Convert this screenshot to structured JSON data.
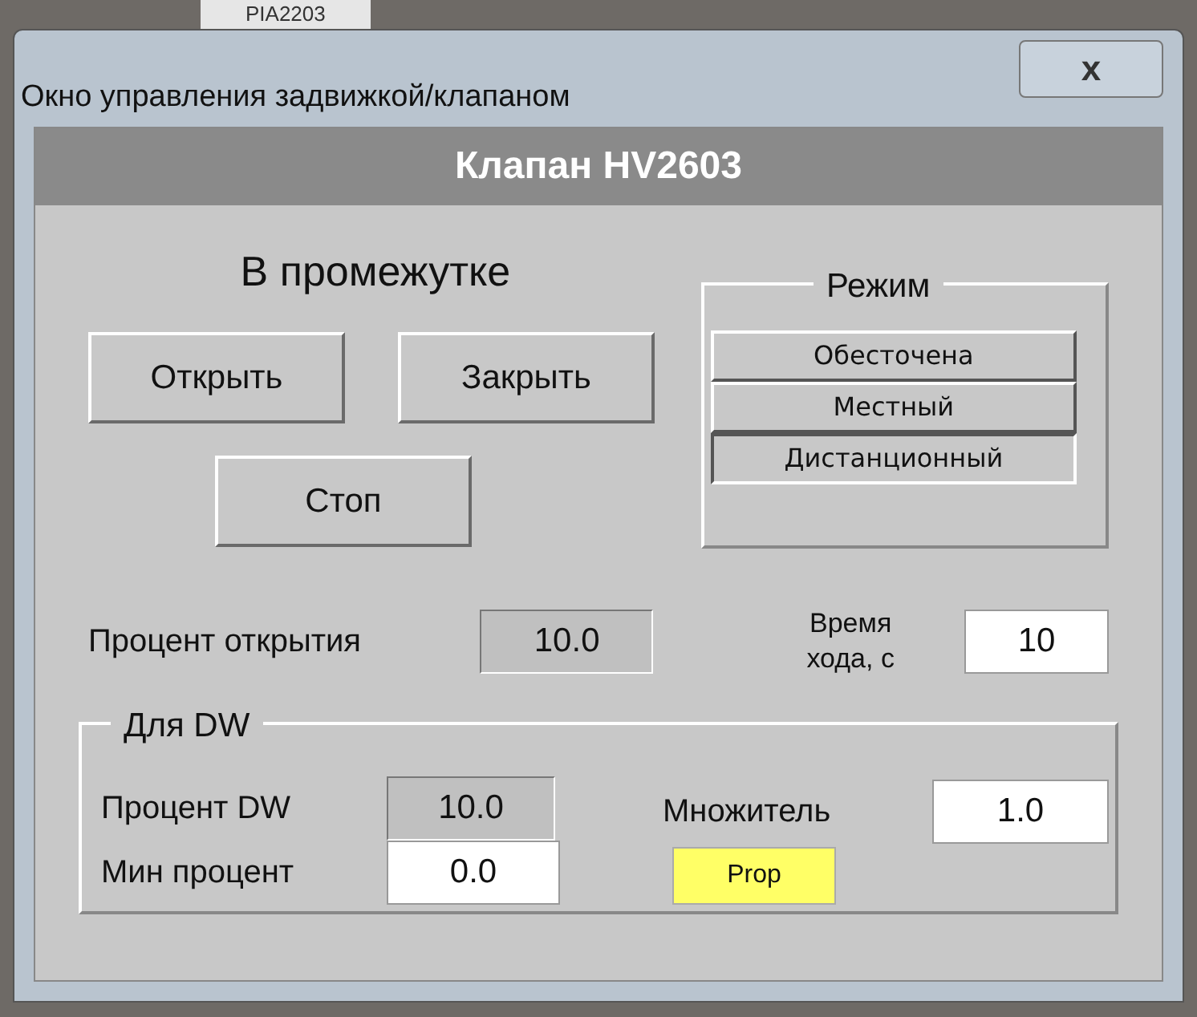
{
  "background": {
    "tag": "PIA2203"
  },
  "window": {
    "title": "Окно управления задвижкой/клапаном",
    "close": "x"
  },
  "header": "Клапан HV2603",
  "status": "В промежутке",
  "buttons": [
    {
      "label": "Открыть"
    },
    {
      "label": "Закрыть"
    },
    {
      "label": "Стоп"
    }
  ],
  "mode": {
    "legend": "Режим",
    "options": [
      {
        "label": "Обесточена",
        "selected": false
      },
      {
        "label": "Местный",
        "selected": false
      },
      {
        "label": "Дистанционный",
        "selected": true
      }
    ]
  },
  "open_percent": {
    "label": "Процент открытия",
    "value": "10.0"
  },
  "travel_time": {
    "label": "Время хода, с",
    "value": "10"
  },
  "dw": {
    "legend": "Для DW",
    "percent": {
      "label": "Процент DW",
      "value": "10.0"
    },
    "min_percent": {
      "label": "Мин процент",
      "value": "0.0"
    },
    "multiplier": {
      "label": "Множитель",
      "value": "1.0"
    },
    "prop_button": "Prop"
  }
}
